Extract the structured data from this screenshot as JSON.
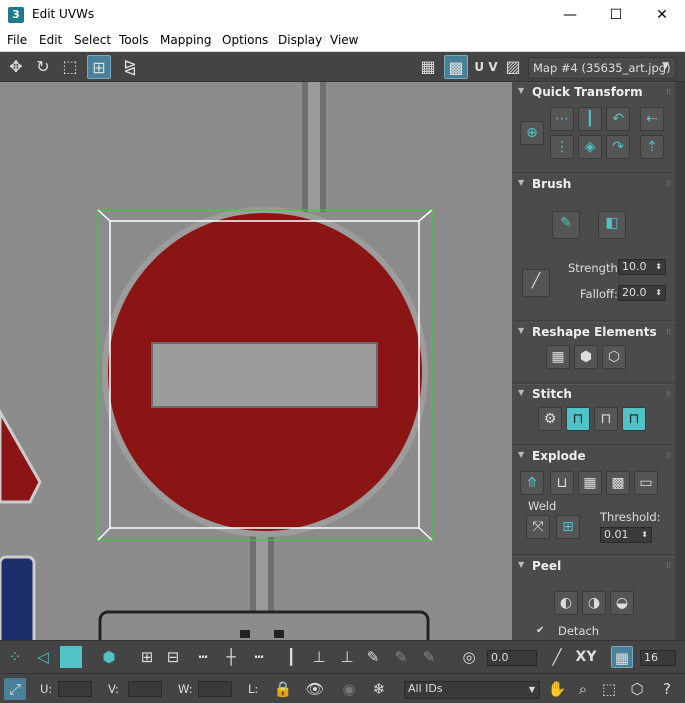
{
  "window": {
    "title": "Edit UVWs",
    "app_icon": "3",
    "minimize": "—",
    "maximize": "☐",
    "close": "✕"
  },
  "menu": [
    "File",
    "Edit",
    "Select",
    "Tools",
    "Mapping",
    "Options",
    "Display",
    "View"
  ],
  "toolbar": {
    "uv_label": "U V",
    "map_select": "Map #4 (35635_art.jpg)"
  },
  "quick_transform": {
    "title": "Quick Transform"
  },
  "brush": {
    "title": "Brush",
    "strength_label": "Strength:",
    "strength_value": "10.0",
    "falloff_label": "Falloff:",
    "falloff_value": "20.0"
  },
  "reshape": {
    "title": "Reshape Elements"
  },
  "stitch": {
    "title": "Stitch"
  },
  "explode": {
    "title": "Explode",
    "weld_label": "Weld",
    "threshold_label": "Threshold:",
    "threshold_value": "0.01"
  },
  "peel": {
    "title": "Peel",
    "detach_label": "Detach"
  },
  "bottom": {
    "offset_value": "0.0",
    "xy_label": "XY",
    "grid_value": "16",
    "u_label": "U:",
    "v_label": "V:",
    "w_label": "W:",
    "l_label": "L:",
    "ids_select": "All IDs"
  },
  "colors": {
    "accent": "#4fc3c8",
    "sign_red": "#8b1515",
    "selection_green": "#32d232",
    "viewport_bg": "#8c8c8c"
  }
}
